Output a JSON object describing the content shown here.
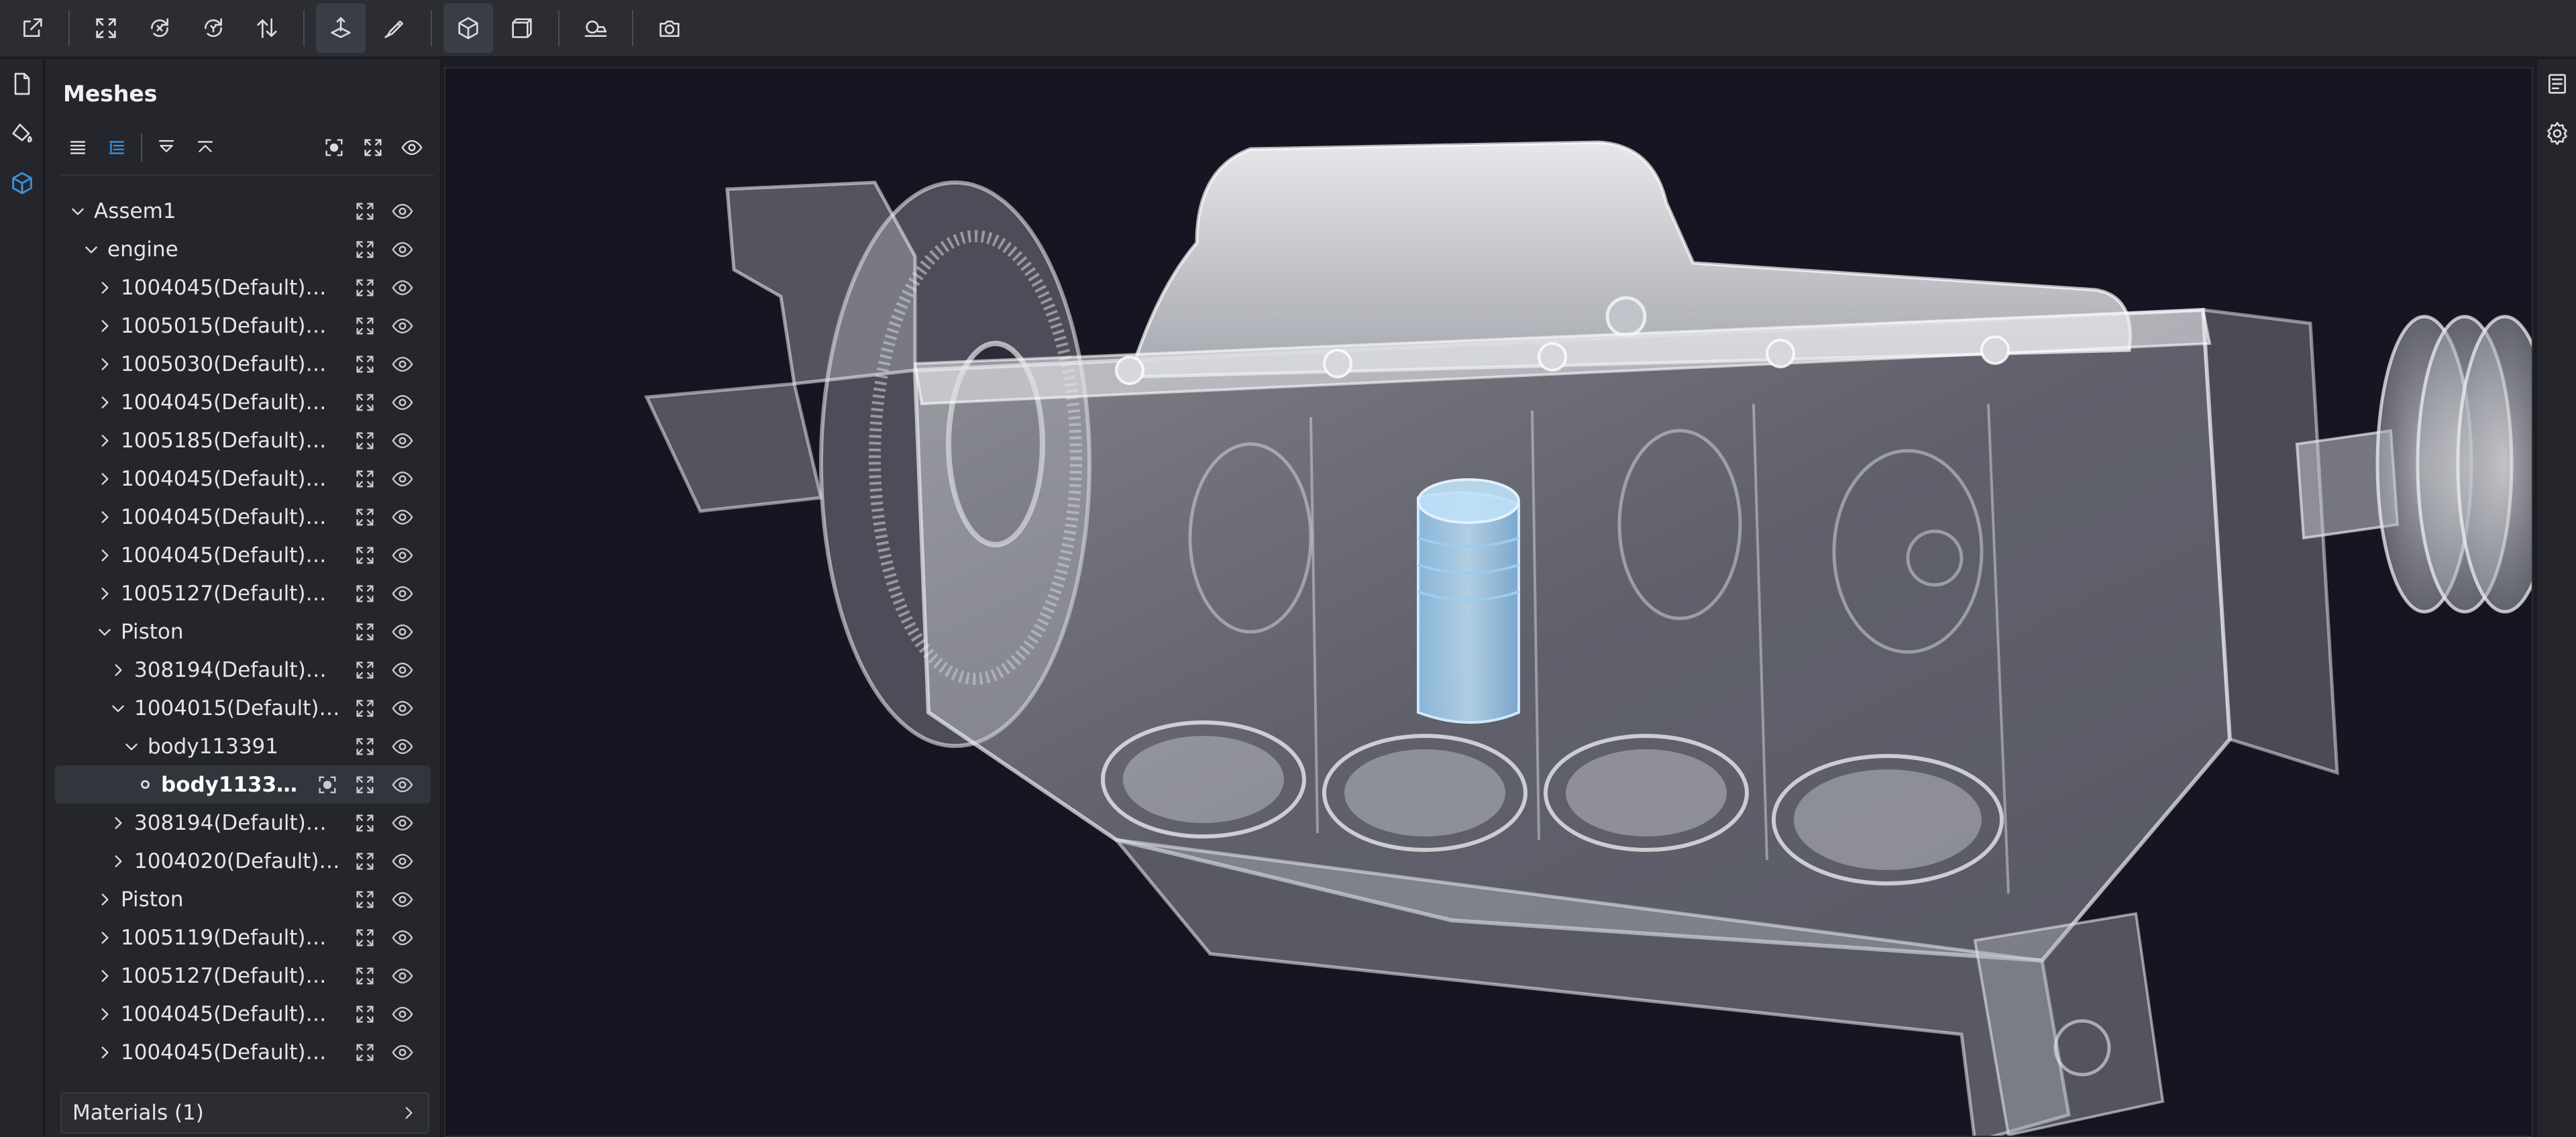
{
  "toolbar": {
    "buttons": [
      {
        "name": "import-model-button",
        "icon": "export-icon"
      },
      {
        "name": "fit-view-button",
        "icon": "fit-view-icon"
      },
      {
        "name": "rotate-x-button",
        "icon": "rotate-x-icon"
      },
      {
        "name": "rotate-y-button",
        "icon": "rotate-y-icon"
      },
      {
        "name": "flip-up-axis-button",
        "icon": "swap-vertical-icon"
      },
      {
        "name": "ground-tool-button",
        "icon": "ground-icon"
      },
      {
        "name": "measure-tool-button",
        "icon": "pen-icon"
      },
      {
        "name": "perspective-camera-button",
        "icon": "cube-icon"
      },
      {
        "name": "orthographic-camera-button",
        "icon": "box-icon"
      },
      {
        "name": "environment-button",
        "icon": "environment-icon"
      },
      {
        "name": "screenshot-button",
        "icon": "camera-icon"
      }
    ]
  },
  "left_rail": [
    "file-icon",
    "materials-icon",
    "meshes-icon"
  ],
  "right_rail": [
    "details-icon",
    "settings-icon"
  ],
  "panel": {
    "title": "Meshes",
    "materials_label": "Materials (1)"
  },
  "tree": [
    {
      "label": "Assem1",
      "level": 0,
      "state": "expanded"
    },
    {
      "label": "engine",
      "level": 1,
      "state": "expanded"
    },
    {
      "label": "1004045(Default)D…",
      "level": 2,
      "state": "collapsed"
    },
    {
      "label": "1005015(Default)Di…",
      "level": 2,
      "state": "collapsed"
    },
    {
      "label": "1005030(Default)D…",
      "level": 2,
      "state": "collapsed"
    },
    {
      "label": "1004045(Default)D…",
      "level": 2,
      "state": "collapsed"
    },
    {
      "label": "1005185(Default)Di…",
      "level": 2,
      "state": "collapsed"
    },
    {
      "label": "1004045(Default)D…",
      "level": 2,
      "state": "collapsed"
    },
    {
      "label": "1004045(Default)D…",
      "level": 2,
      "state": "collapsed"
    },
    {
      "label": "1004045(Default)D…",
      "level": 2,
      "state": "collapsed"
    },
    {
      "label": "1005127(Default)Di…",
      "level": 2,
      "state": "collapsed"
    },
    {
      "label": "Piston",
      "level": 2,
      "state": "expanded"
    },
    {
      "label": "308194(Default)D…",
      "level": 3,
      "state": "collapsed"
    },
    {
      "label": "1004015(Default)…",
      "level": 3,
      "state": "expanded"
    },
    {
      "label": "body113391",
      "level": 4,
      "state": "expanded"
    },
    {
      "label": "body113391",
      "level": 5,
      "state": "leaf",
      "selected": true
    },
    {
      "label": "308194(Default)D…",
      "level": 3,
      "state": "collapsed"
    },
    {
      "label": "1004020(Default)…",
      "level": 3,
      "state": "collapsed"
    },
    {
      "label": "Piston",
      "level": 2,
      "state": "collapsed"
    },
    {
      "label": "1005119(Default)Di…",
      "level": 2,
      "state": "collapsed"
    },
    {
      "label": "1005127(Default)Di…",
      "level": 2,
      "state": "collapsed"
    },
    {
      "label": "1004045(Default)D…",
      "level": 2,
      "state": "collapsed"
    },
    {
      "label": "1004045(Default)D…",
      "level": 2,
      "state": "collapsed"
    }
  ],
  "colors": {
    "accent": "#3b8fd6",
    "viewport_bg": "#161522",
    "highlight_part": "#9fd0f2"
  }
}
